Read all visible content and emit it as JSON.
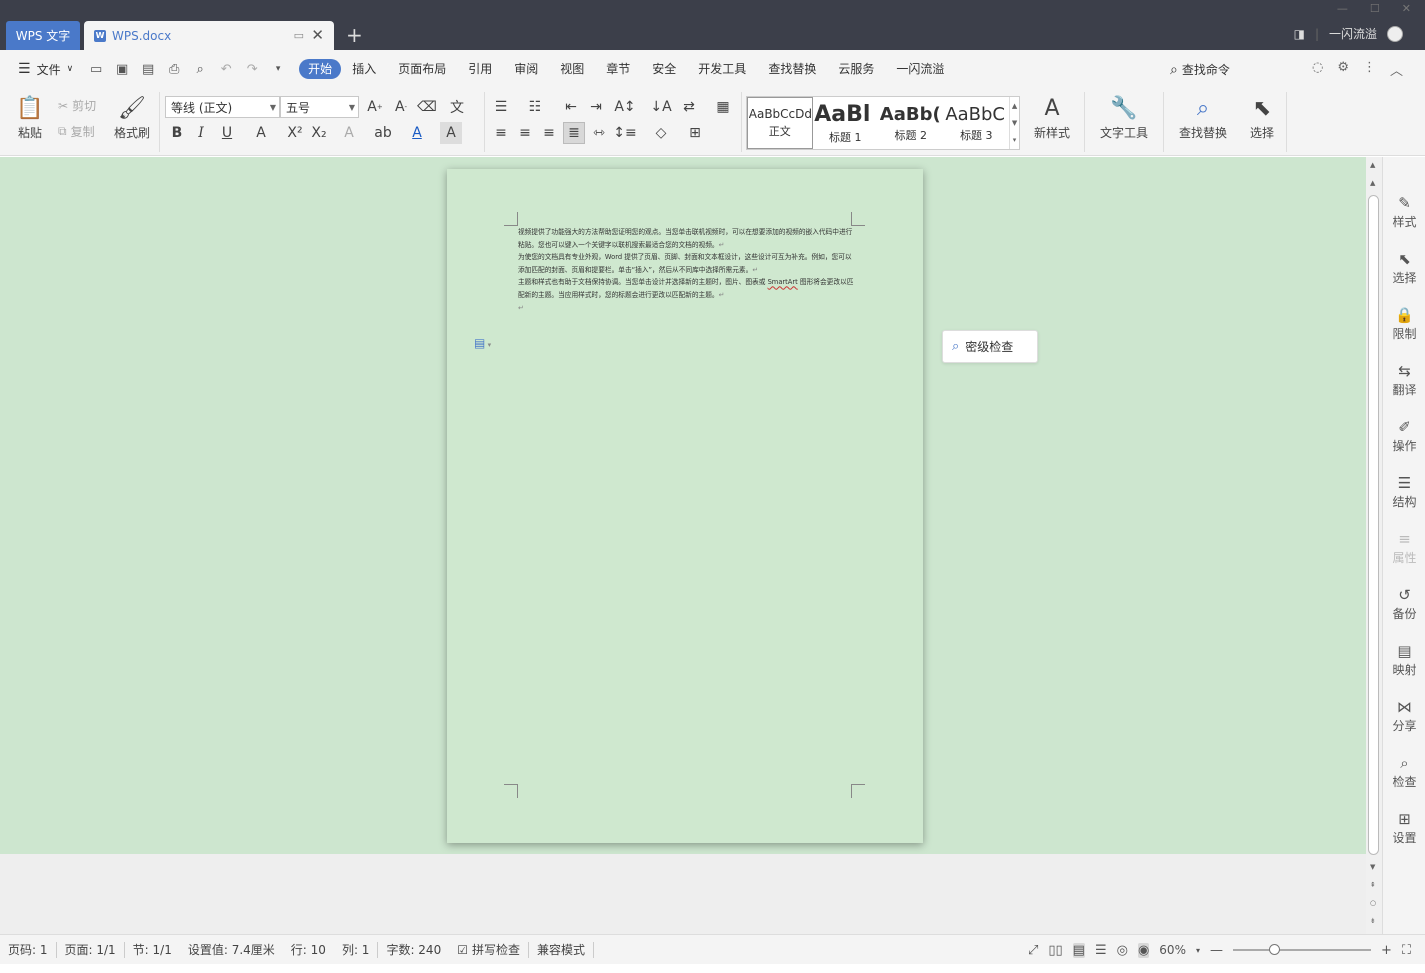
{
  "titlebar": {
    "app_tab": "WPS 文字",
    "doc_tab": "WPS.docx",
    "new_tab": "+",
    "user": "一闪流溢"
  },
  "menubar": {
    "file": "文件",
    "tabs": [
      "开始",
      "插入",
      "页面布局",
      "引用",
      "审阅",
      "视图",
      "章节",
      "安全",
      "开发工具",
      "查找替换",
      "云服务",
      "一闪流溢"
    ],
    "active_tab": "开始",
    "search": "查找命令"
  },
  "ribbon": {
    "paste": "粘贴",
    "cut": "剪切",
    "copy": "复制",
    "format_painter": "格式刷",
    "font_name": "等线 (正文)",
    "font_size": "五号",
    "styles": [
      {
        "sample": "AaBbCcDd",
        "name": "正文"
      },
      {
        "sample": "AaBl",
        "name": "标题 1"
      },
      {
        "sample": "AaBb(",
        "name": "标题 2"
      },
      {
        "sample": "AaBbC",
        "name": "标题 3"
      }
    ],
    "new_style": "新样式",
    "text_tools": "文字工具",
    "find_replace": "查找替换",
    "select": "选择"
  },
  "document": {
    "para1": "视频提供了功能强大的方法帮助您证明您的观点。当您单击联机视频时，可以在想要添加的视频的嵌入代码中进行粘贴。您也可以键入一个关键字以联机搜索最适合您的文档的视频。",
    "para2": "为使您的文档具有专业外观，Word 提供了页眉、页脚、封面和文本框设计，这些设计可互为补充。例如，您可以添加匹配的封面、页眉和提要栏。单击“插入”，然后从不同库中选择所需元素。",
    "para3_word": "SmartArt",
    "para3_start": "主题和样式也有助于文档保持协调。当您单击设计并选择新的主题时，图片、图表或 ",
    "para3_end": " 图形将会更改以匹配新的主题。当应用样式时，您的标题会进行更改以匹配新的主题。",
    "pilcrow": "↵"
  },
  "popup": {
    "secret_check": "密级检查"
  },
  "right_panel": [
    {
      "icon": "pen-icon",
      "label": "样式"
    },
    {
      "icon": "cursor-icon",
      "label": "选择"
    },
    {
      "icon": "lock-icon",
      "label": "限制"
    },
    {
      "icon": "translate-icon",
      "label": "翻译"
    },
    {
      "icon": "edit-icon",
      "label": "操作"
    },
    {
      "icon": "structure-icon",
      "label": "结构"
    },
    {
      "icon": "property-icon",
      "label": "属性"
    },
    {
      "icon": "history-icon",
      "label": "备份"
    },
    {
      "icon": "mapping-icon",
      "label": "映射"
    },
    {
      "icon": "share-icon",
      "label": "分享"
    },
    {
      "icon": "check-icon",
      "label": "检查"
    },
    {
      "icon": "settings-grid-icon",
      "label": "设置"
    }
  ],
  "statusbar": {
    "page_num": "页码: 1",
    "pages": "页面: 1/1",
    "section": "节: 1/1",
    "setting": "设置值: 7.4厘米",
    "row": "行: 10",
    "col": "列: 1",
    "word_count": "字数: 240",
    "spell_check": "拼写检查",
    "compat": "兼容模式",
    "zoom": "60%",
    "zoom_fraction": 0.3
  },
  "colors": {
    "accent": "#4a79c9",
    "titlebar": "#3c3f4a",
    "workspace": "#cde6cf",
    "page": "#cfe8cf"
  }
}
